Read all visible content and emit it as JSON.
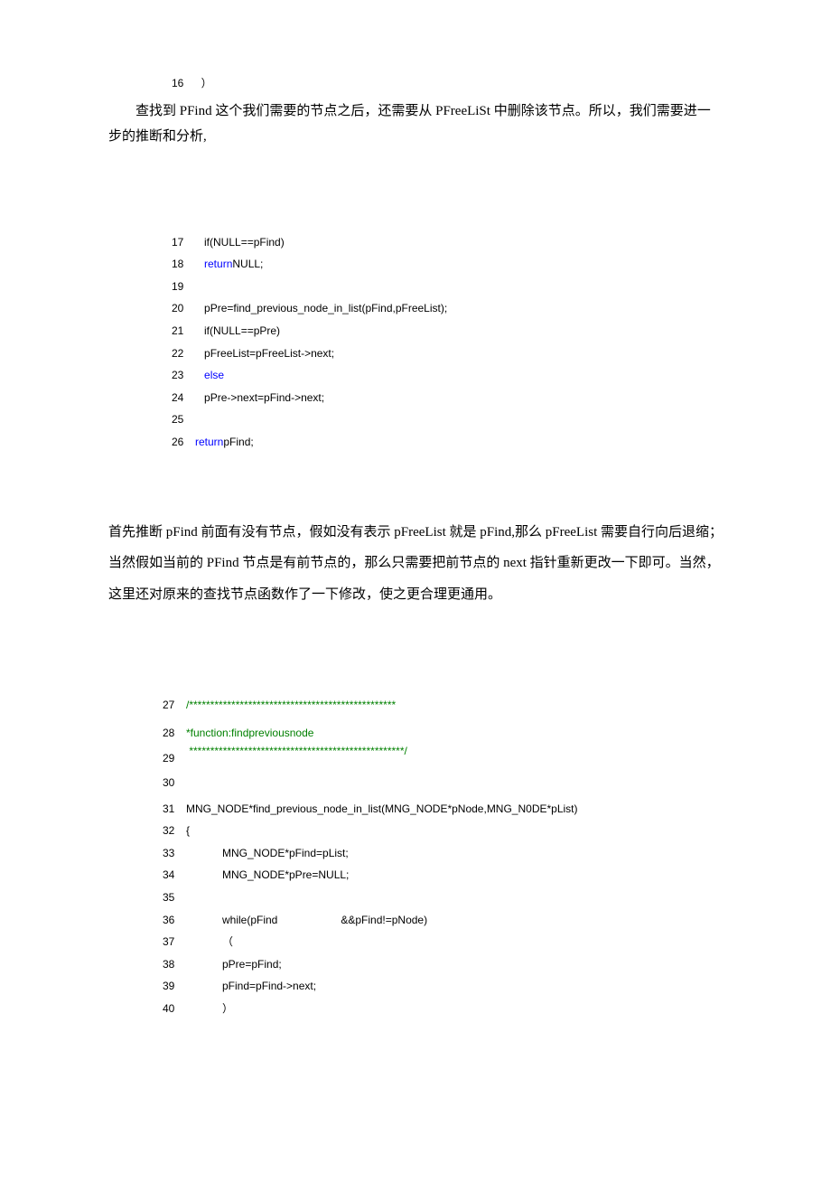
{
  "code1": {
    "l16": {
      "num": "16",
      "text": "）"
    }
  },
  "para1": "查找到 PFind 这个我们需要的节点之后，还需要从 PFreeLiSt 中删除该节点。所以，我们需要进一步的推断和分析,",
  "code2": {
    "l17": {
      "num": "17",
      "a": "if(NULL==pFind)"
    },
    "l18": {
      "num": "18",
      "kw": "return",
      "b": "NULL;"
    },
    "l19": {
      "num": "19",
      "a": ""
    },
    "l20": {
      "num": "20",
      "a": "pPre=find_previous_node_in_list(pFind,pFreeList);"
    },
    "l21": {
      "num": "21",
      "a": "if(NULL==pPre)"
    },
    "l22": {
      "num": "22",
      "a": "pFreeList=pFreeList->next;"
    },
    "l23": {
      "num": "23",
      "kw": "else"
    },
    "l24": {
      "num": "24",
      "a": "pPre->next=pFind->next;"
    },
    "l25": {
      "num": "25",
      "a": ""
    },
    "l26": {
      "num": "26",
      "kw": "return",
      "b": "pFind;"
    }
  },
  "para2": "首先推断 pFind 前面有没有节点，假如没有表示 pFreeList 就是 pFind,那么 pFreeList 需要自行向后退缩；当然假如当前的 PFind 节点是有前节点的，那么只需要把前节点的 next 指针重新更改一下即可。当然，这里还对原来的查找节点函数作了一下修改，使之更合理更通用。",
  "code3": {
    "l27": {
      "num": "27",
      "comment": "/*************************************************"
    },
    "l28": {
      "num": "28",
      "comment": "*function:findpreviousnode"
    },
    "l29": {
      "num": "29",
      "comment": "***************************************************/"
    },
    "l30": {
      "num": "30",
      "a": ""
    },
    "l31": {
      "num": "31",
      "a": "MNG_NODE*find_previous_node_in_list(MNG_NODE*pNode,MNG_N0DE*pList)"
    },
    "l32": {
      "num": "32",
      "a": "{"
    },
    "l33": {
      "num": "33",
      "a": "MNG_NODE*pFind=pList;"
    },
    "l34": {
      "num": "34",
      "a": "MNG_NODE*pPre=NULL;"
    },
    "l35": {
      "num": "35",
      "a": ""
    },
    "l36": {
      "num": "36",
      "a": "while(pFind",
      "b": "&&pFind!=pNode)"
    },
    "l37": {
      "num": "37",
      "a": "（"
    },
    "l38": {
      "num": "38",
      "a": "pPre=pFind;"
    },
    "l39": {
      "num": "39",
      "a": "pFind=pFind->next;"
    },
    "l40": {
      "num": "40",
      "a": "）"
    }
  }
}
